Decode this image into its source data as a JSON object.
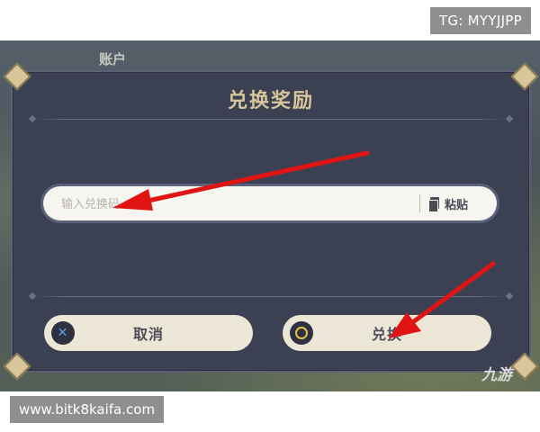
{
  "badges": {
    "telegram": "TG: MYYJJPP",
    "website": "www.bitk8kaifa.com"
  },
  "background": {
    "account_label": "账户"
  },
  "dialog": {
    "title": "兑换奖励",
    "input": {
      "placeholder": "输入兑换码",
      "value": ""
    },
    "paste_label": "粘贴",
    "cancel_label": "取消",
    "confirm_label": "兑换"
  },
  "watermark": {
    "brand": "九游"
  },
  "icons": {
    "paste": "clipboard-icon",
    "cancel": "x-button-icon",
    "confirm": "circle-button-icon"
  },
  "colors": {
    "dialog_bg": "#3b4152",
    "title": "#d8c59a",
    "button_bg": "#ece6d6",
    "arrow": "#e11414"
  }
}
